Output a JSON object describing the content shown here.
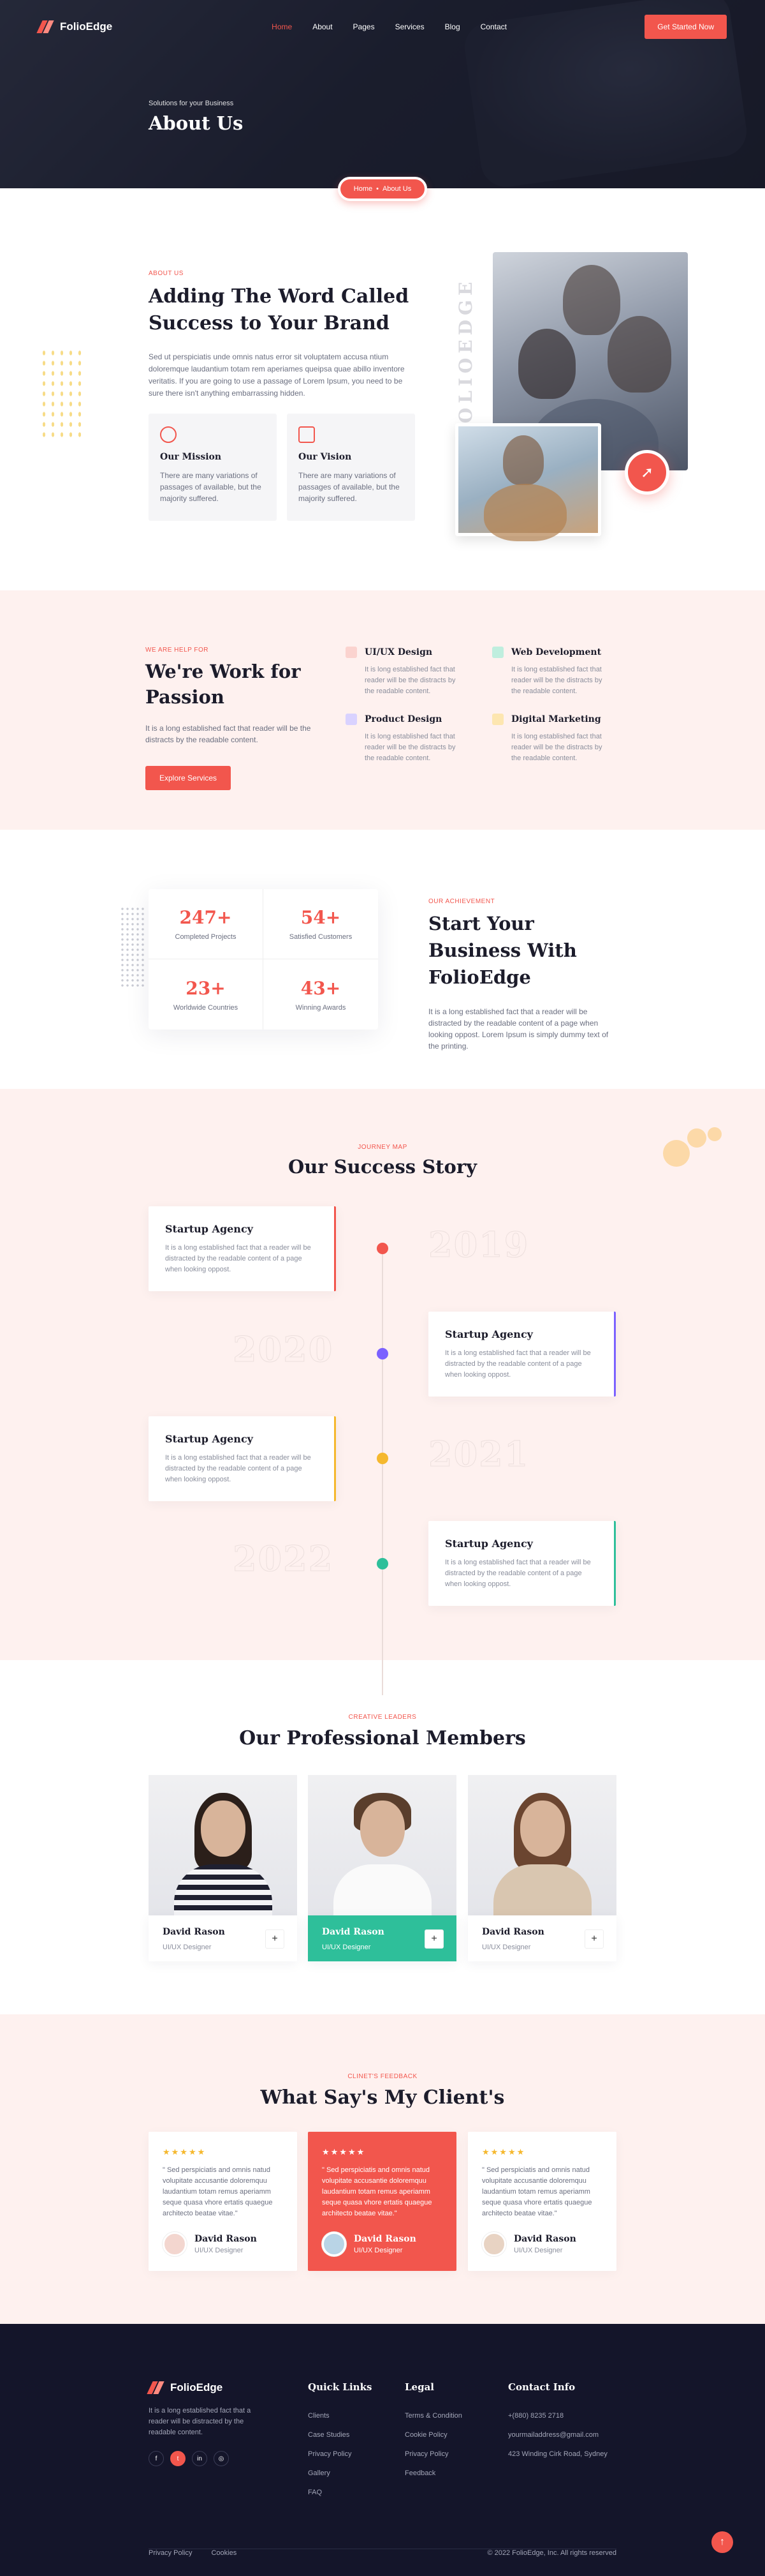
{
  "nav": {
    "brand": "FolioEdge",
    "items": [
      "Home",
      "About",
      "Pages",
      "Services",
      "Blog",
      "Contact"
    ],
    "cta": "Get Started Now"
  },
  "hero": {
    "kicker": "Solutions for your Business",
    "title": "About Us",
    "breadcrumb": [
      "Home",
      "About Us"
    ]
  },
  "about": {
    "eyebrow": "ABOUT US",
    "title": "Adding The Word Called Success to Your Brand",
    "body": "Sed ut perspiciatis unde omnis natus error sit voluptatem accusa ntium doloremque laudantium totam rem aperiames queipsa quae abillo inventore veritatis. If you are going to use a passage of Lorem Ipsum, you need to be sure there isn't anything embarrassing hidden.",
    "vertical_label": "FOLIOEDGE",
    "cards": [
      {
        "title": "Our Mission",
        "text": "There are many variations of passages of available, but the majority suffered."
      },
      {
        "title": "Our Vision",
        "text": "There are many variations of passages of available, but the majority suffered."
      }
    ]
  },
  "work": {
    "eyebrow": "WE ARE HELP FOR",
    "title": "We're Work for Passion",
    "text": "It is a long established fact that reader will be the distracts by the readable content.",
    "button": "Explore Services",
    "services": [
      {
        "title": "UI/UX Design",
        "text": "It is long established fact that reader will be the distracts by the readable content.",
        "color": "#f2564d"
      },
      {
        "title": "Web Development",
        "text": "It is long established fact that reader will be the distracts by the readable content.",
        "color": "#2ebf9a"
      },
      {
        "title": "Product Design",
        "text": "It is long established fact that reader will be the distracts by the readable content.",
        "color": "#7b61ff"
      },
      {
        "title": "Digital Marketing",
        "text": "It is long established fact that reader will be the distracts by the readable content.",
        "color": "#f5b82e"
      }
    ]
  },
  "achievement": {
    "stats": [
      {
        "num": "247+",
        "label": "Completed Projects"
      },
      {
        "num": "54+",
        "label": "Satisfied Customers"
      },
      {
        "num": "23+",
        "label": "Worldwide Countries"
      },
      {
        "num": "43+",
        "label": "Winning Awards"
      }
    ],
    "eyebrow": "OUR ACHIEVEMENT",
    "title": "Start Your Business With FolioEdge",
    "text": "It is a long established fact that a reader will be distracted by the readable content of a page when looking oppost. Lorem Ipsum is simply dummy text of the printing."
  },
  "journey": {
    "eyebrow": "JOURNEY MAP",
    "title": "Our Success Story",
    "items": [
      {
        "title": "Startup Agency",
        "text": "It is a long established fact that a reader will be distracted by the readable content of a page when looking oppost.",
        "year": "2019",
        "color": "#f2564d"
      },
      {
        "title": "Startup Agency",
        "text": "It is a long established fact that a reader will be distracted by the readable content of a page when looking oppost.",
        "year": "2020",
        "color": "#7b61ff"
      },
      {
        "title": "Startup Agency",
        "text": "It is a long established fact that a reader will be distracted by the readable content of a page when looking oppost.",
        "year": "2021",
        "color": "#f5b82e"
      },
      {
        "title": "Startup Agency",
        "text": "It is a long established fact that a reader will be distracted by the readable content of a page when looking oppost.",
        "year": "2022",
        "color": "#2ebf9a"
      }
    ]
  },
  "team": {
    "eyebrow": "CREATIVE LEADERS",
    "title": "Our Professional Members",
    "members": [
      {
        "name": "David Rason",
        "role": "UI/UX Designer"
      },
      {
        "name": "David Rason",
        "role": "UI/UX Designer"
      },
      {
        "name": "David Rason",
        "role": "UI/UX Designer"
      }
    ]
  },
  "testimonials": {
    "eyebrow": "CLINET'S FEEDBACK",
    "title": "What Say's My Client's",
    "items": [
      {
        "stars": "★★★★★",
        "quote": "\" Sed perspiciatis and omnis natud volupitate accusantie doloremquu laudantium totam remus aperiamm seque quasa vhore ertatis quaegue architecto beatae vitae.\"",
        "name": "David Rason",
        "role": "UI/UX Designer"
      },
      {
        "stars": "★★★★★",
        "quote": "\" Sed perspiciatis and omnis natud volupitate accusantie doloremquu laudantium totam remus aperiamm seque quasa vhore ertatis quaegue architecto beatae vitae.\"",
        "name": "David Rason",
        "role": "UI/UX Designer"
      },
      {
        "stars": "★★★★★",
        "quote": "\" Sed perspiciatis and omnis natud volupitate accusantie doloremquu laudantium totam remus aperiamm seque quasa vhore ertatis quaegue architecto beatae vitae.\"",
        "name": "David Rason",
        "role": "UI/UX Designer"
      }
    ]
  },
  "footer": {
    "brand": "FolioEdge",
    "about": "It is a long established fact that a reader will be distracted by the readable content.",
    "quick_title": "Quick Links",
    "quick": [
      "Clients",
      "Case Studies",
      "Privacy Policy",
      "Gallery",
      "FAQ"
    ],
    "legal_title": "Legal",
    "legal": [
      "Terms & Condition",
      "Cookie Policy",
      "Privacy Policy",
      "Feedback"
    ],
    "contact_title": "Contact Info",
    "contact": [
      "+(880) 8235 2718",
      "yourmailaddress@gmail.com",
      "423 Winding Cirk Road, Sydney"
    ],
    "bottom_links": [
      "Privacy Policy",
      "Cookies"
    ],
    "copyright": "© 2022 FolioEdge, Inc. All rights reserved"
  },
  "colors": {
    "accent": "#f2564d",
    "dark": "#14152a",
    "blush": "#fef1ef"
  }
}
